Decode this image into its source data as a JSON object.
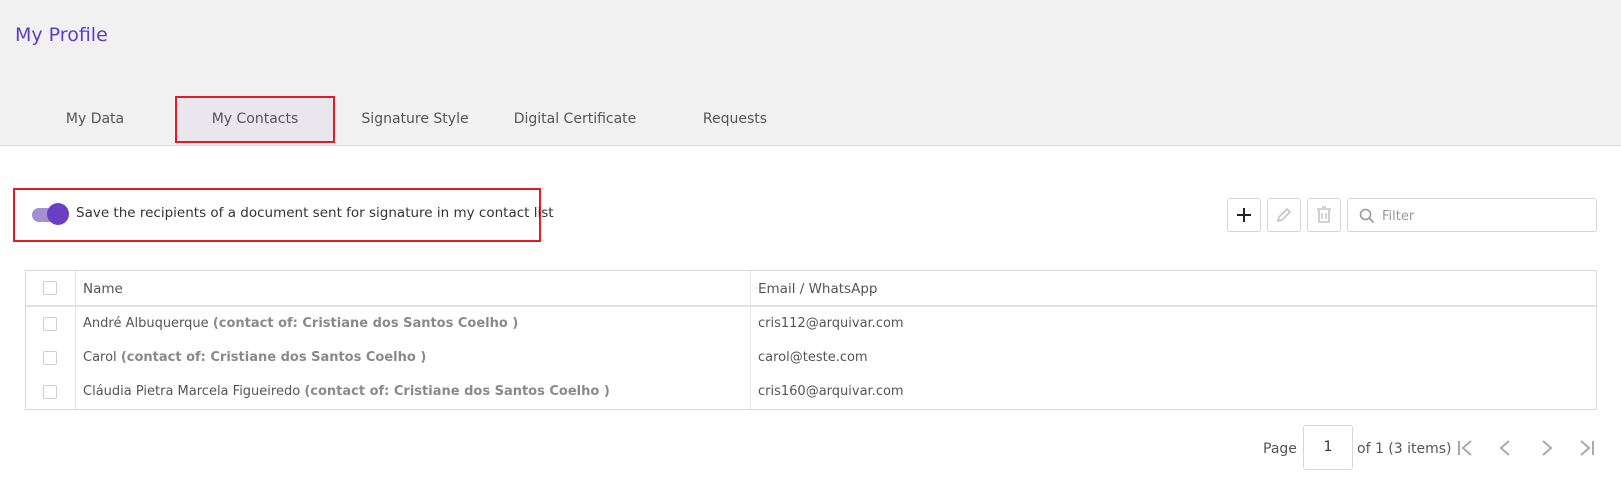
{
  "header": {
    "title": "My Profile"
  },
  "tabs": [
    {
      "label": "My Data"
    },
    {
      "label": "My Contacts"
    },
    {
      "label": "Signature Style"
    },
    {
      "label": "Digital Certificate"
    },
    {
      "label": "Requests"
    }
  ],
  "active_tab": "My Contacts",
  "toggle": {
    "label": "Save the recipients of a document sent for signature in my contact list",
    "on": true
  },
  "toolbar": {
    "add_icon": "plus-icon",
    "edit_icon": "pencil-icon",
    "delete_icon": "trash-icon",
    "filter_placeholder": "Filter"
  },
  "table": {
    "columns": [
      "Name",
      "Email / WhatsApp"
    ],
    "rows": [
      {
        "name": "André Albuquerque",
        "owner": "(contact of: Cristiane dos Santos Coelho )",
        "email": "cris112@arquivar.com"
      },
      {
        "name": "Carol",
        "owner": "(contact of: Cristiane dos Santos Coelho )",
        "email": "carol@teste.com"
      },
      {
        "name": "Cláudia Pietra Marcela Figueiredo",
        "owner": "(contact of: Cristiane dos Santos Coelho )",
        "email": "cris160@arquivar.com"
      }
    ]
  },
  "pager": {
    "page_label": "Page",
    "page": "1",
    "summary": "of 1 (3 items)"
  },
  "colors": {
    "accent": "#5a3ec8",
    "highlight_border": "#e31b23",
    "toggle_track": "#a48fd6",
    "toggle_knob": "#6a3fc4"
  }
}
